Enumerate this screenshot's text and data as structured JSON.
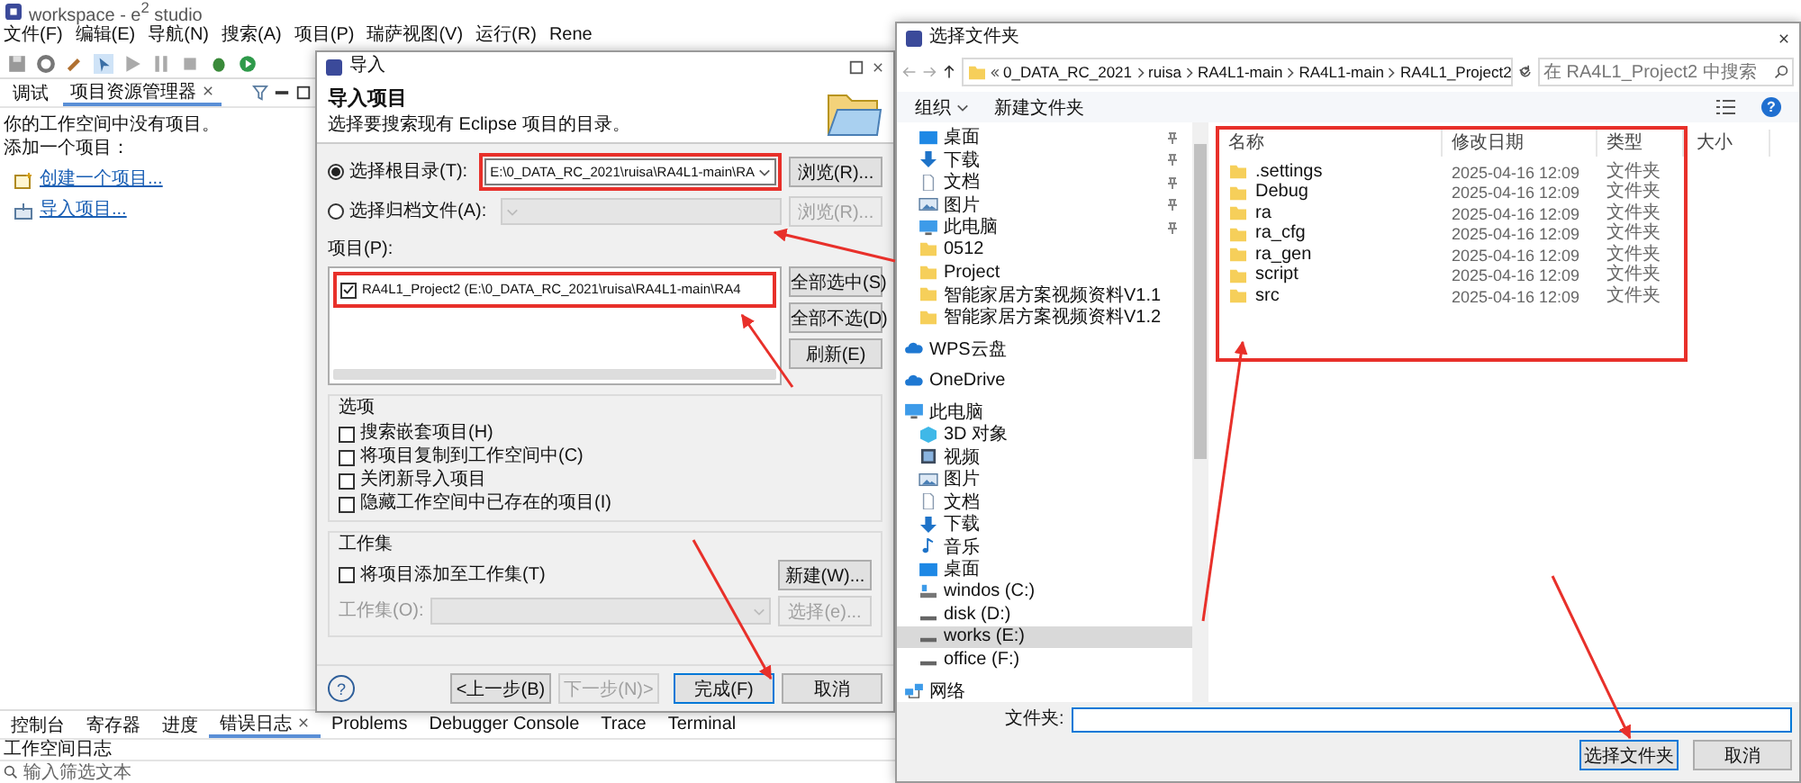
{
  "eclipse": {
    "title": "workspace - e$^{2}$ studio",
    "menu": [
      "文件(F)",
      "编辑(E)",
      "导航(N)",
      "搜索(A)",
      "项目(P)",
      "瑞萨视图(V)",
      "运行(R)",
      "Rene"
    ],
    "explorer_tabs": [
      {
        "label": "调试",
        "selected": false
      },
      {
        "label": "项目资源管理器",
        "selected": true
      }
    ],
    "explorer_lines": [
      "你的工作空间中没有项目。",
      "添加一个项目："
    ],
    "explorer_links": [
      {
        "label": "创建一个项目...",
        "kind": "create"
      },
      {
        "label": "导入项目...",
        "kind": "import"
      }
    ],
    "bottom_tabs": [
      {
        "label": "控制台",
        "selected": false
      },
      {
        "label": "寄存器",
        "selected": false
      },
      {
        "label": "进度",
        "selected": false
      },
      {
        "label": "错误日志",
        "selected": true
      },
      {
        "label": "Problems",
        "selected": false
      },
      {
        "label": "Debugger Console",
        "selected": false
      },
      {
        "label": "Trace",
        "selected": false
      },
      {
        "label": "Terminal",
        "selected": false
      }
    ],
    "log_title": "工作空间日志",
    "filter": {
      "placeholder": "输入筛选文本"
    }
  },
  "import_dialog": {
    "title": "导入",
    "heading": "导入项目",
    "description": "选择要搜索现有 Eclipse 项目的目录。",
    "sources": [
      {
        "label": "选择根目录(T):",
        "selected": true,
        "disabled": false,
        "value": "E:\\0_DATA_RC_2021\\ruisa\\RA4L1-main\\RA",
        "browse": "浏览(R)..."
      },
      {
        "label": "选择归档文件(A):",
        "selected": false,
        "disabled": true,
        "browse": "浏览(R)..."
      }
    ],
    "projects_label": "项目(P):",
    "projects": [
      {
        "label": "RA4L1_Project2  (E:\\0_DATA_RC_2021\\ruisa\\RA4L1-main\\RA4",
        "checked": true
      }
    ],
    "project_buttons": [
      "全部选中(S)",
      "全部不选(D)",
      "刷新(E)"
    ],
    "options_title": "选项",
    "options": [
      {
        "label": "搜索嵌套项目(H)",
        "checked": false
      },
      {
        "label": "将项目复制到工作空间中(C)",
        "checked": false
      },
      {
        "label": "关闭新导入项目",
        "checked": false
      },
      {
        "label": "隐藏工作空间中已存在的项目(I)",
        "checked": false
      }
    ],
    "working_sets": {
      "title": "工作集",
      "add": {
        "label": "将项目添加至工作集(T)",
        "checked": false
      },
      "new_button": "新建(W)...",
      "field_label": "工作集(O):",
      "select_button": "选择(e)...",
      "disabled": true
    },
    "help": "?",
    "footer": [
      {
        "label": "<上一步(B)",
        "disabled": false,
        "default": false
      },
      {
        "label": "下一步(N)>",
        "disabled": true,
        "default": false
      },
      {
        "label": "完成(F)",
        "disabled": false,
        "default": true
      },
      {
        "label": "取消",
        "disabled": false,
        "default": false
      }
    ]
  },
  "folder_dialog": {
    "title": "选择文件夹",
    "breadcrumb": [
      "0_DATA_RC_2021",
      "ruisa",
      "RA4L1-main",
      "RA4L1-main",
      "RA4L1_Project2"
    ],
    "search": {
      "placeholder": "在 RA4L1_Project2 中搜索"
    },
    "toolbar": [
      "组织",
      "新建文件夹"
    ],
    "help": "?",
    "quick_access": [
      {
        "label": "桌面",
        "kind": "desktop",
        "pinned": true,
        "selected": false
      },
      {
        "label": "下载",
        "kind": "download",
        "pinned": true,
        "selected": false
      },
      {
        "label": "文档",
        "kind": "document",
        "pinned": true,
        "selected": false
      },
      {
        "label": "图片",
        "kind": "picture",
        "pinned": true,
        "selected": false
      },
      {
        "label": "此电脑",
        "kind": "computer",
        "pinned": true,
        "selected": false
      },
      {
        "label": "0512",
        "kind": "folder",
        "pinned": false,
        "selected": false
      },
      {
        "label": "Project",
        "kind": "folder",
        "pinned": false,
        "selected": false
      },
      {
        "label": "智能家居方案视频资料V1.1",
        "kind": "folder",
        "pinned": false,
        "selected": false
      },
      {
        "label": "智能家居方案视频资料V1.2",
        "kind": "folder",
        "pinned": false,
        "selected": false
      }
    ],
    "nav": [
      {
        "label": "WPS云盘",
        "kind": "cloud",
        "selected": false
      },
      {
        "label": "OneDrive",
        "kind": "cloud",
        "selected": false
      },
      {
        "label": "此电脑",
        "kind": "computer",
        "selected": false,
        "children": [
          {
            "label": "3D 对象",
            "kind": "cube",
            "selected": false
          },
          {
            "label": "视频",
            "kind": "video",
            "selected": false
          },
          {
            "label": "图片",
            "kind": "picture",
            "selected": false
          },
          {
            "label": "文档",
            "kind": "document",
            "selected": false
          },
          {
            "label": "下载",
            "kind": "download",
            "selected": false
          },
          {
            "label": "音乐",
            "kind": "music",
            "selected": false
          },
          {
            "label": "桌面",
            "kind": "desktop",
            "selected": false
          },
          {
            "label": "windos (C:)",
            "kind": "system-drive",
            "selected": false
          },
          {
            "label": "disk (D:)",
            "kind": "drive",
            "selected": false
          },
          {
            "label": "works (E:)",
            "kind": "drive",
            "selected": true
          },
          {
            "label": "office (F:)",
            "kind": "drive",
            "selected": false
          }
        ]
      },
      {
        "label": "网络",
        "kind": "network",
        "selected": false
      }
    ],
    "columns": [
      "名称",
      "修改日期",
      "类型",
      "大小"
    ],
    "rows": [
      {
        "name": ".settings",
        "modified": "2025-04-16 12:09",
        "type": "文件夹"
      },
      {
        "name": "Debug",
        "modified": "2025-04-16 12:09",
        "type": "文件夹"
      },
      {
        "name": "ra",
        "modified": "2025-04-16 12:09",
        "type": "文件夹"
      },
      {
        "name": "ra_cfg",
        "modified": "2025-04-16 12:09",
        "type": "文件夹"
      },
      {
        "name": "ra_gen",
        "modified": "2025-04-16 12:09",
        "type": "文件夹"
      },
      {
        "name": "script",
        "modified": "2025-04-16 12:09",
        "type": "文件夹"
      },
      {
        "name": "src",
        "modified": "2025-04-16 12:09",
        "type": "文件夹"
      }
    ],
    "filename_label": "文件夹:",
    "buttons": [
      {
        "label": "选择文件夹",
        "default": true
      },
      {
        "label": "取消",
        "default": false
      }
    ]
  }
}
